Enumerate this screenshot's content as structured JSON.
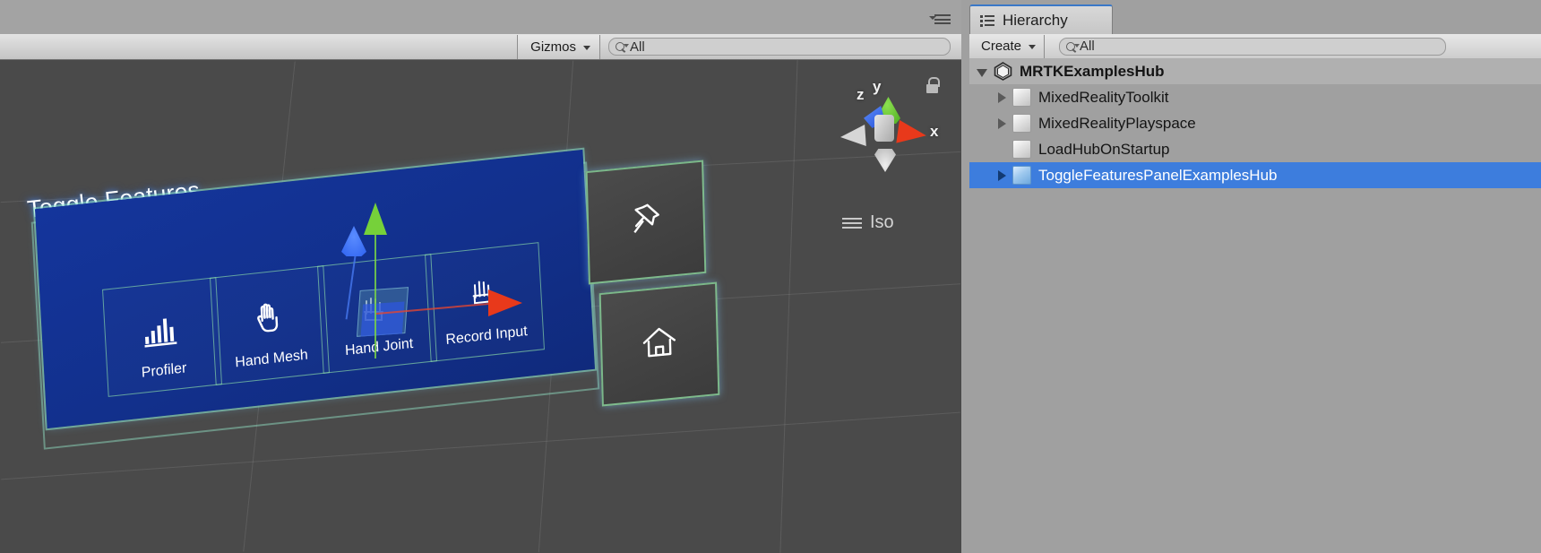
{
  "scene_view": {
    "menu_icon": "panel-menu-icon",
    "toolbar": {
      "gizmos_label": "Gizmos",
      "gizmos_caret": "chevron-down-icon",
      "search_value": "All",
      "search_placeholder": "All",
      "search_icon": "search-icon"
    },
    "lock_icon": "lock-icon",
    "axis_gizmo": {
      "x_label": "x",
      "y_label": "y",
      "z_label": "z",
      "x_color": "#e8391b",
      "y_color": "#76d13a",
      "z_color": "#3f74f0"
    },
    "projection_label": "Iso",
    "projection_icon": "hamburger-icon",
    "background_color": "#4a4a4a"
  },
  "mrtk_panel": {
    "title": "Toggle Features",
    "panel_color": "#12308c",
    "outline_color": "#8ce6c8",
    "buttons": [
      {
        "label": "Profiler",
        "icon": "bar-chart-icon"
      },
      {
        "label": "Hand Mesh",
        "icon": "hand-icon"
      },
      {
        "label": "Hand Joint",
        "icon": "hand-joints-icon"
      },
      {
        "label": "Record Input",
        "icon": "hand-joints-icon"
      }
    ],
    "side_buttons": [
      {
        "name": "pin-button",
        "icon": "pin-icon"
      },
      {
        "name": "home-button",
        "icon": "home-icon"
      }
    ],
    "translate_gizmo": {
      "x_axis_color": "#e8391b",
      "y_axis_color": "#76d13a",
      "z_axis_color": "#3f74f0"
    }
  },
  "hierarchy": {
    "tab_label": "Hierarchy",
    "tab_icon": "hierarchy-icon",
    "create_label": "Create",
    "create_caret": "chevron-down-icon",
    "search_value": "All",
    "search_placeholder": "All",
    "search_icon": "search-icon",
    "selection_color": "#3d7ddd",
    "tree": [
      {
        "label": "MRTKExamplesHub",
        "depth": 0,
        "expanded": true,
        "icon": "unity-logo-icon",
        "has_children": true,
        "selected": false
      },
      {
        "label": "MixedRealityToolkit",
        "depth": 1,
        "expanded": false,
        "icon": "cube-icon",
        "has_children": true,
        "selected": false
      },
      {
        "label": "MixedRealityPlayspace",
        "depth": 1,
        "expanded": false,
        "icon": "cube-icon",
        "has_children": true,
        "selected": false
      },
      {
        "label": "LoadHubOnStartup",
        "depth": 1,
        "expanded": false,
        "icon": "cube-icon",
        "has_children": false,
        "selected": false
      },
      {
        "label": "ToggleFeaturesPanelExamplesHub",
        "depth": 1,
        "expanded": false,
        "icon": "cube-icon-blue",
        "has_children": true,
        "selected": true
      }
    ]
  }
}
